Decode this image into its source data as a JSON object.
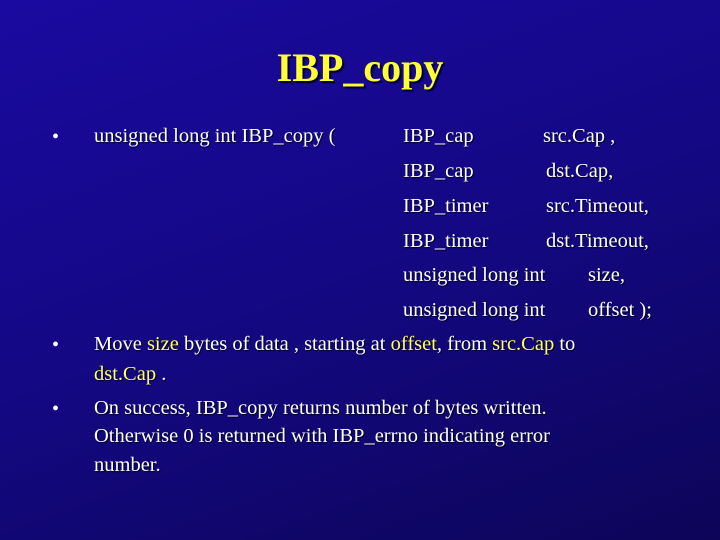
{
  "slide": {
    "title": "IBP_copy",
    "signature": {
      "prefix": "unsigned long int   IBP_copy (",
      "params": [
        {
          "type": "IBP_cap",
          "name": "src.Cap ,"
        },
        {
          "type": "IBP_cap",
          "name": "dst.Cap,"
        },
        {
          "type": "IBP_timer",
          "name": "src.Timeout,"
        },
        {
          "type": "IBP_timer",
          "name": "dst.Timeout,"
        },
        {
          "type": "unsigned long int",
          "name": "size,"
        },
        {
          "type": "unsigned long int",
          "name": "offset );"
        }
      ]
    },
    "bullet2": {
      "t1": "Move ",
      "h1": "size",
      "t2": " bytes of data , starting at ",
      "h2": "offset",
      "t3": ",  from ",
      "h3": "src.Cap",
      "t4": " to",
      "h4": "dst.Cap",
      "t5": " ."
    },
    "bullet3": {
      "line1": "On success, IBP_copy returns number of bytes written.",
      "line2": "Otherwise 0 is returned with IBP_errno indicating error",
      "line3": "number."
    },
    "bullet_char": "•",
    "colors": {
      "title": "#ffff33",
      "highlight": "#ffff66",
      "text": "#ffffff"
    }
  }
}
